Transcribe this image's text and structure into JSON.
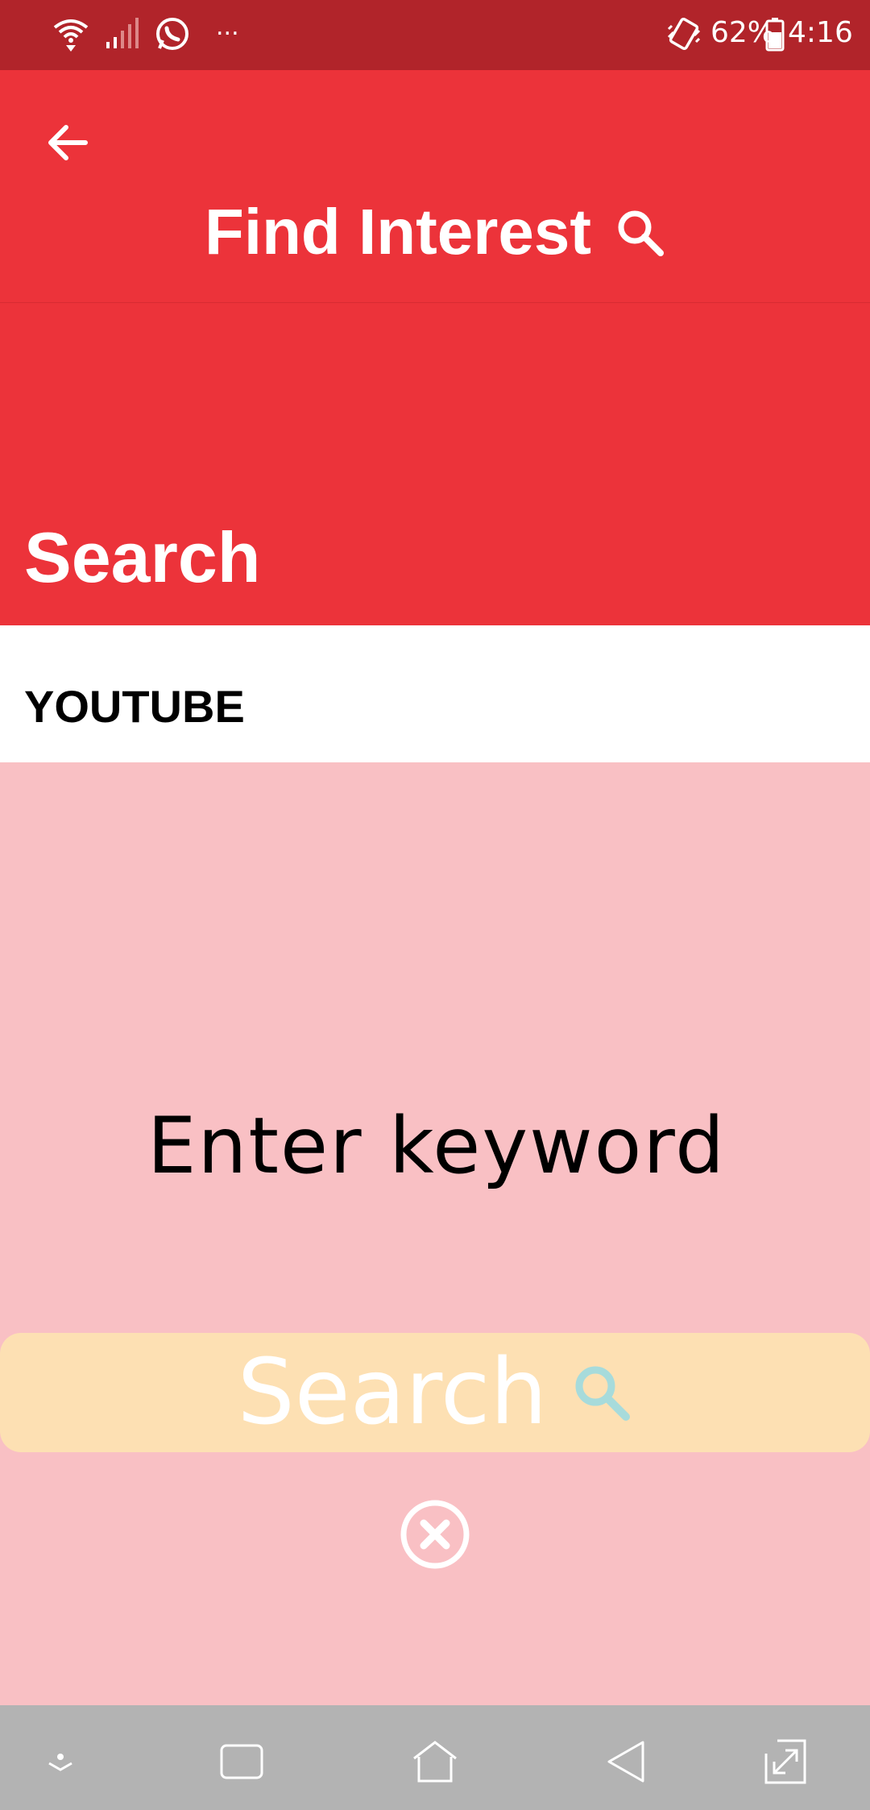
{
  "status_bar": {
    "icons": [
      "wifi-icon",
      "signal-icon",
      "whatsapp-icon",
      "more-notifications-icon",
      "vibrate-icon",
      "battery-icon"
    ],
    "overflow": "...",
    "battery": "62%",
    "time": "4:16"
  },
  "app_bar": {
    "title": "Find Interest",
    "back_icon": "back-arrow-icon",
    "title_icon": "search-icon"
  },
  "hero": {
    "label": "Search"
  },
  "tab": {
    "label": "YOUTUBE"
  },
  "form": {
    "keyword_placeholder": "Enter keyword",
    "search_button_label": "Search",
    "search_button_icon": "search-icon",
    "clear_icon": "close-circle-icon"
  },
  "nav_bar": {
    "icons": [
      "hide-nav-icon",
      "recents-icon",
      "home-icon",
      "back-icon",
      "screen-rotate-icon"
    ]
  },
  "colors": {
    "status_bar": "#b1242a",
    "primary": "#ec333a",
    "content_bg": "#f9c0c4",
    "button_bg": "#fde0b3",
    "button_icon": "#a7dbdb",
    "nav_bar": "#b3b3b3"
  }
}
